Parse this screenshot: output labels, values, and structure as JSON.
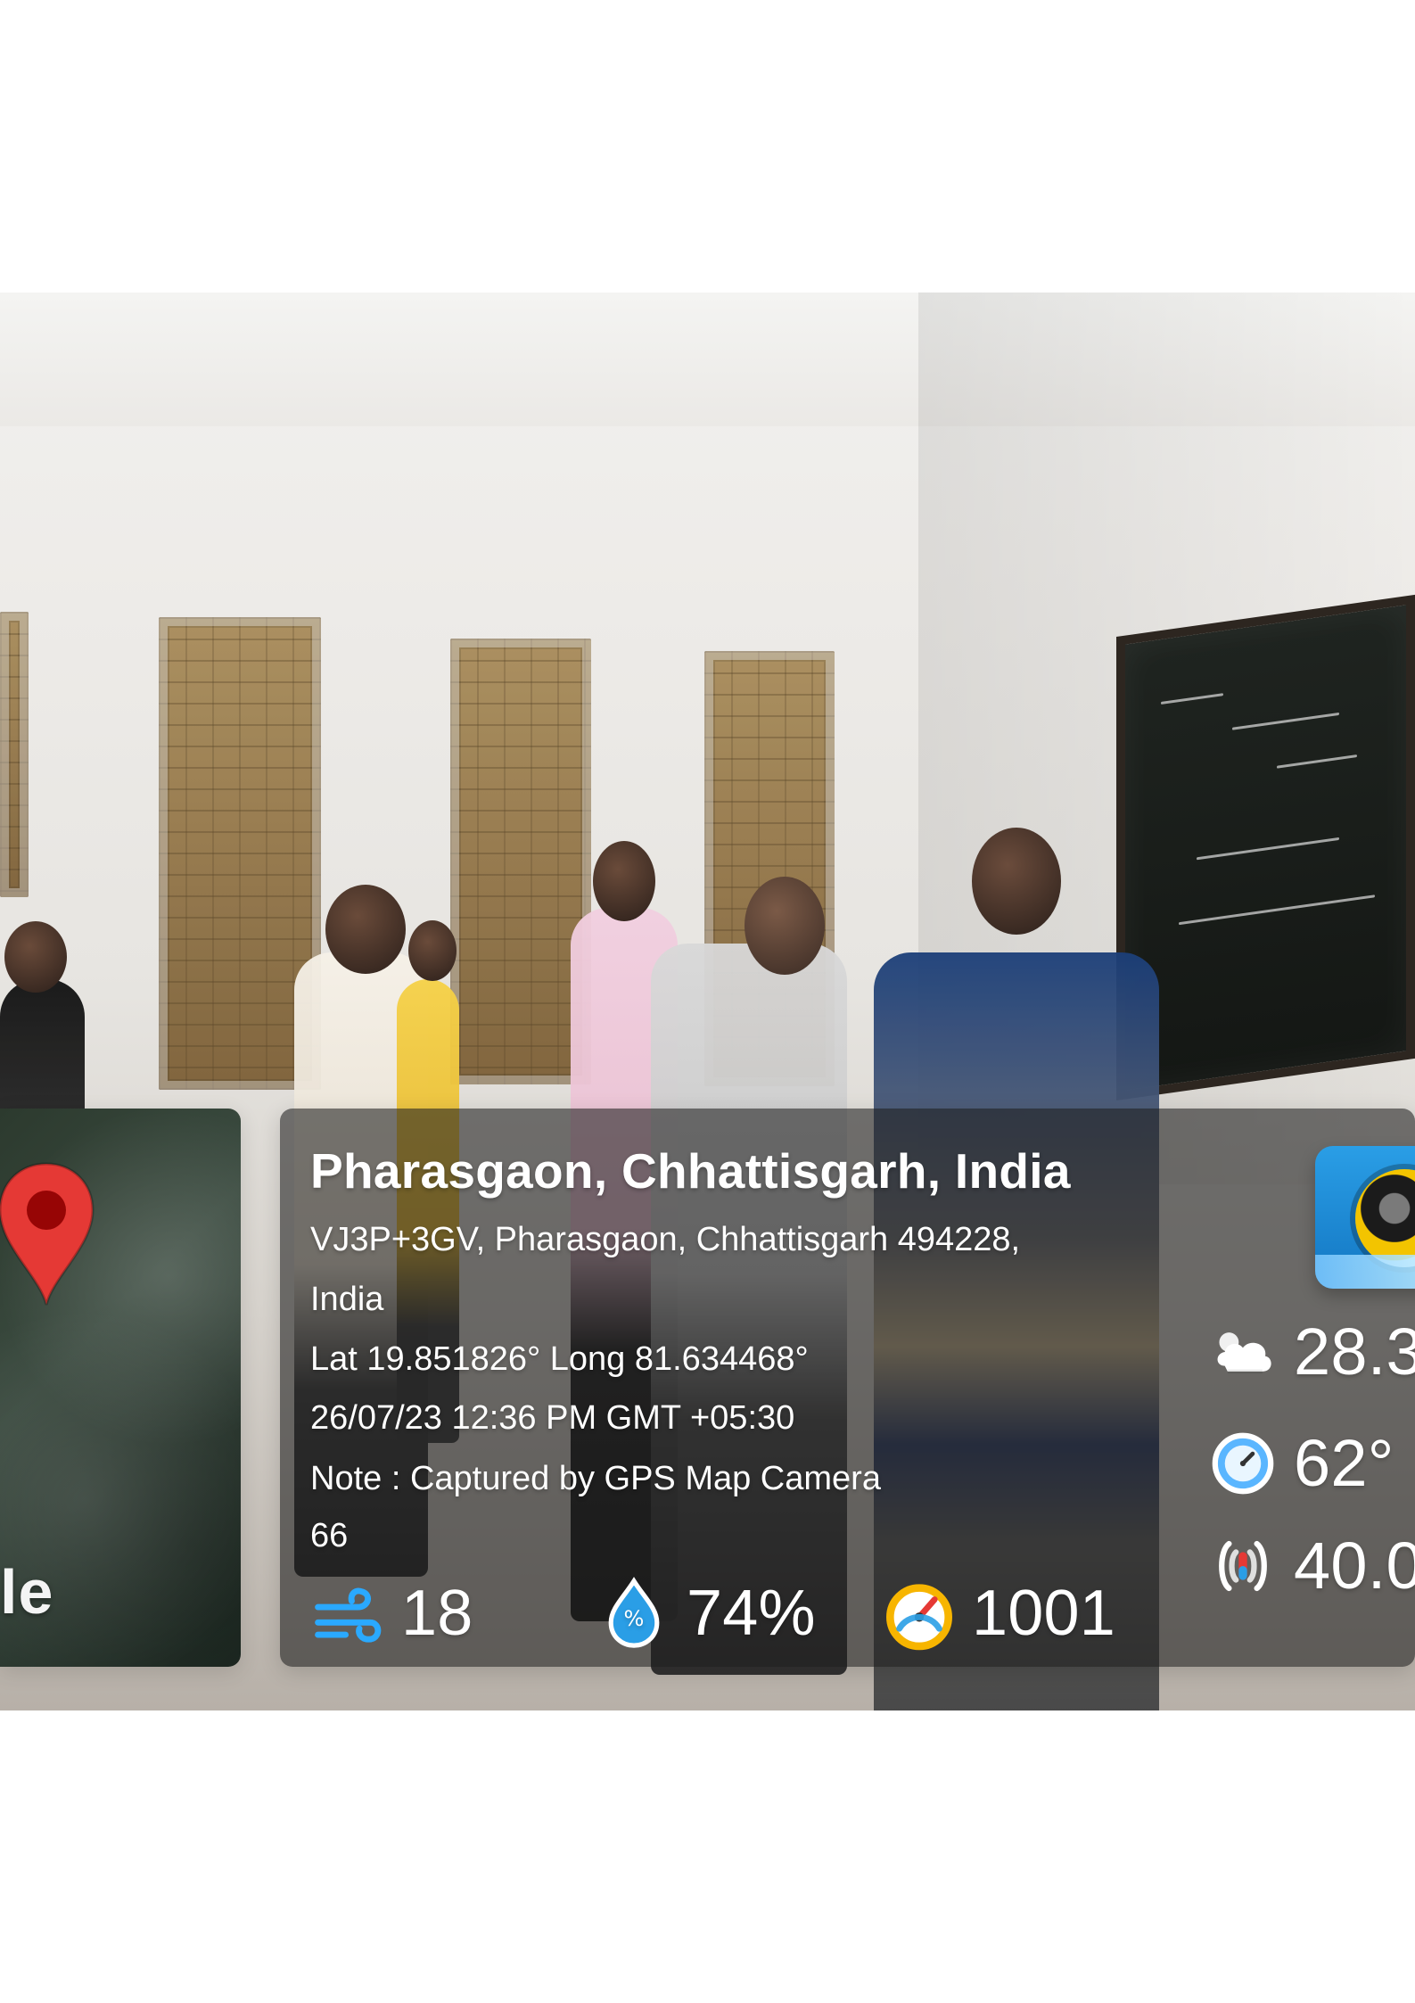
{
  "overlay": {
    "location_title": "Pharasgaon, Chhattisgarh, India",
    "address_line_1": "VJ3P+3GV, Pharasgaon, Chhattisgarh 494228,",
    "address_line_2": "India",
    "lat_long": "Lat 19.851826° Long 81.634468°",
    "datetime": "26/07/23 12:36 PM GMT +05:30",
    "note": "Note : Captured by GPS Map Camera",
    "note_suffix": "66",
    "metrics": {
      "wind": "18",
      "humidity": "74%",
      "pressure": "1001"
    },
    "right": {
      "temperature": "28.3",
      "direction": "62°",
      "magnetic": "40.0"
    }
  },
  "map_thumb": {
    "google_text": "le"
  },
  "icons": {
    "map_pin": "map-pin-icon",
    "wind": "wind-icon",
    "humidity": "humidity-icon",
    "pressure": "pressure-gauge-icon",
    "weather": "weather-icon",
    "compass": "compass-icon",
    "magnetic": "magnetic-field-icon",
    "app_camera": "camera-app-icon"
  },
  "colors": {
    "overlay_bg": "#1c1c1c",
    "accent_blue": "#2a9ee6",
    "pin_red": "#e53935"
  }
}
